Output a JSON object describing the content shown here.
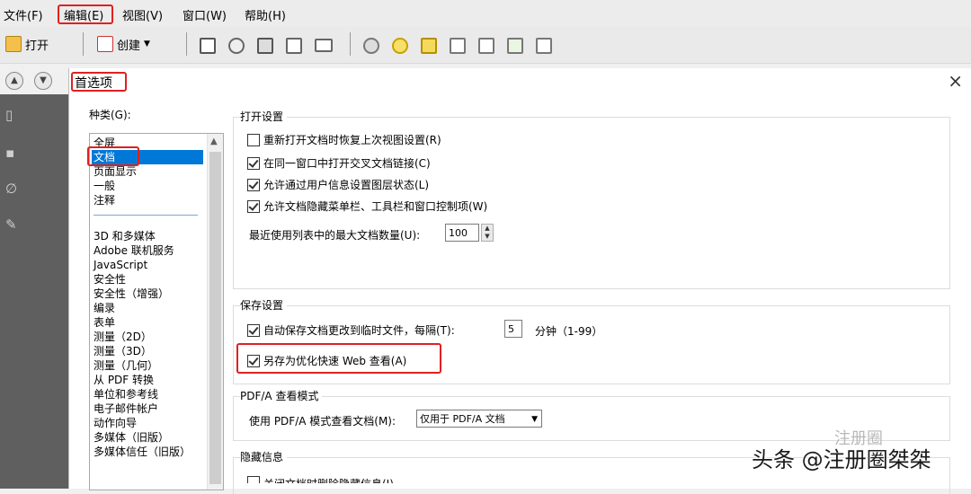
{
  "menubar": {
    "items": [
      "文件(F)",
      "编辑(E)",
      "视图(V)",
      "窗口(W)",
      "帮助(H)"
    ]
  },
  "toolbar": {
    "open_label": "打开",
    "create_label": "创建",
    "icons": [
      "folder-open-icon",
      "create-icon",
      "save-icon",
      "upload-icon",
      "print-icon",
      "edit-icon",
      "mail-icon",
      "gear-icon",
      "comment-icon",
      "highlight-icon",
      "pdf-icon",
      "doc-icon",
      "export-icon",
      "clipboard-icon"
    ]
  },
  "dialog": {
    "title": "首选项",
    "close": "×",
    "categories_label": "种类(G):",
    "categories": [
      "全屏",
      "文档",
      "页面显示",
      "一般",
      "注释",
      "3D 和多媒体",
      "Adobe 联机服务",
      "JavaScript",
      "安全性",
      "安全性（增强）",
      "编录",
      "表单",
      "测量（2D）",
      "测量（3D）",
      "测量（几何）",
      "从 PDF 转换",
      "单位和参考线",
      "电子邮件帐户",
      "动作向导",
      "多媒体（旧版）",
      "多媒体信任（旧版）"
    ],
    "selected_category": "文档",
    "open_settings": {
      "title": "打开设置",
      "options": [
        {
          "label": "重新打开文档时恢复上次视图设置(R)",
          "checked": false
        },
        {
          "label": "在同一窗口中打开交叉文档链接(C)",
          "checked": true
        },
        {
          "label": "允许通过用户信息设置图层状态(L)",
          "checked": true
        },
        {
          "label": "允许文档隐藏菜单栏、工具栏和窗口控制项(W)",
          "checked": true
        }
      ],
      "recent_label": "最近使用列表中的最大文档数量(U):",
      "recent_value": "100"
    },
    "save_settings": {
      "title": "保存设置",
      "autosave_label": "自动保存文档更改到临时文件，每隔(T):",
      "autosave_checked": true,
      "autosave_value": "5",
      "autosave_unit": "分钟（1-99）",
      "fastweb_label": "另存为优化快速 Web 查看(A)",
      "fastweb_checked": true
    },
    "pdfa": {
      "title": "PDF/A 查看模式",
      "label": "使用 PDF/A 模式查看文档(M):",
      "value": "仅用于 PDF/A 文档"
    },
    "hidden_info": {
      "title": "隐藏信息",
      "partial_option": "关闭文档时删除隐藏信息(I)"
    }
  },
  "watermark": {
    "text": "头条 @注册圈桀桀",
    "faint": "注册圈"
  },
  "colors": {
    "highlight": "#e02020",
    "selection": "#0078d7"
  }
}
